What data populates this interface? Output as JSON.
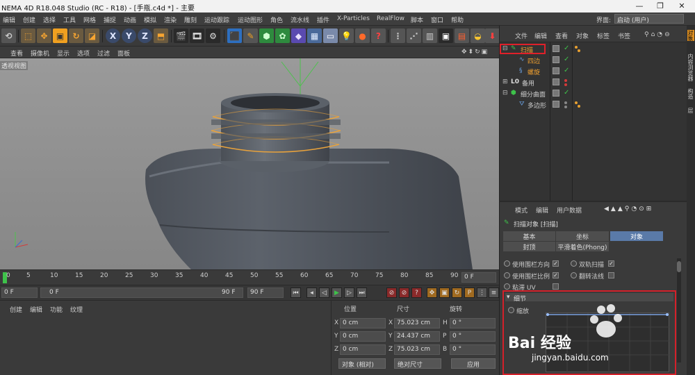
{
  "window": {
    "title": "NEMA 4D R18.048 Studio (RC - R18) - [手瓶.c4d *] - 主要"
  },
  "menubar": {
    "items": [
      "编辑",
      "创建",
      "选择",
      "工具",
      "网格",
      "捕捉",
      "动画",
      "模拟",
      "渲染",
      "雕刻",
      "运动跟踪",
      "运动图形",
      "角色",
      "流水线",
      "插件",
      "X-Particles",
      "RealFlow",
      "脚本",
      "窗口",
      "帮助"
    ],
    "layout_label": "界面:",
    "layout_value": "启动 (用户)"
  },
  "viewport": {
    "menu": [
      "查看",
      "摄像机",
      "显示",
      "选项",
      "过滤",
      "面板"
    ],
    "label": "透视视图"
  },
  "timeline": {
    "ticks": [
      "0",
      "5",
      "10",
      "15",
      "20",
      "25",
      "30",
      "35",
      "40",
      "45",
      "50",
      "55",
      "60",
      "65",
      "70",
      "75",
      "80",
      "85",
      "90"
    ],
    "current_frame": "0 F"
  },
  "transport": {
    "start": "0 F",
    "slider_start": "0 F",
    "slider_end": "90 F",
    "end": "90 F"
  },
  "materials": {
    "menu": [
      "创建",
      "编辑",
      "功能",
      "纹理"
    ]
  },
  "coordinates": {
    "headers": [
      "位置",
      "尺寸",
      "旋转"
    ],
    "rows": [
      {
        "pos_label": "X",
        "pos": "0 cm",
        "size_label": "X",
        "size": "75.023 cm",
        "rot_label": "H",
        "rot": "0 °"
      },
      {
        "pos_label": "Y",
        "pos": "0 cm",
        "size_label": "Y",
        "size": "24.437 cm",
        "rot_label": "P",
        "rot": "0 °"
      },
      {
        "pos_label": "Z",
        "pos": "0 cm",
        "size_label": "Z",
        "size": "75.023 cm",
        "rot_label": "B",
        "rot": "0 °"
      }
    ],
    "mode": "对象 (相对)",
    "size_mode": "绝对尺寸",
    "apply": "应用"
  },
  "object_manager": {
    "menu": [
      "文件",
      "编辑",
      "查看",
      "对象",
      "标签",
      "书签"
    ],
    "objects": [
      {
        "name": "扫描",
        "color": "#f0a030",
        "selected": true
      },
      {
        "name": "四边",
        "color": "#f0a030"
      },
      {
        "name": "螺旋",
        "color": "#f0a030"
      },
      {
        "name": "备用",
        "color": "#d0d0d0"
      },
      {
        "name": "细分曲面",
        "color": "#d0d0d0"
      },
      {
        "name": "多边形",
        "color": "#d0d0d0"
      }
    ]
  },
  "attributes": {
    "menu": [
      "模式",
      "编辑",
      "用户数据"
    ],
    "object_title": "扫描对象 [扫描]",
    "tabs": [
      "基本",
      "坐标",
      "对象",
      "封顶",
      "平滑着色(Phong)"
    ],
    "options": [
      {
        "label": "使用围栏方向",
        "checked": true
      },
      {
        "label": "双轨扫描",
        "checked": true
      },
      {
        "label": "使用围栏比例",
        "checked": true
      },
      {
        "label": "翻转法线",
        "checked": false
      },
      {
        "label": "粘滞 UV",
        "checked": false
      }
    ],
    "section": "细节",
    "scale_label": "缩放"
  },
  "right_strip": {
    "tabs": [
      "对象",
      "内容浏览器",
      "构造",
      "层"
    ]
  },
  "watermark": {
    "text": "Bai 经验",
    "sub": "jingyan.baidu.com"
  }
}
